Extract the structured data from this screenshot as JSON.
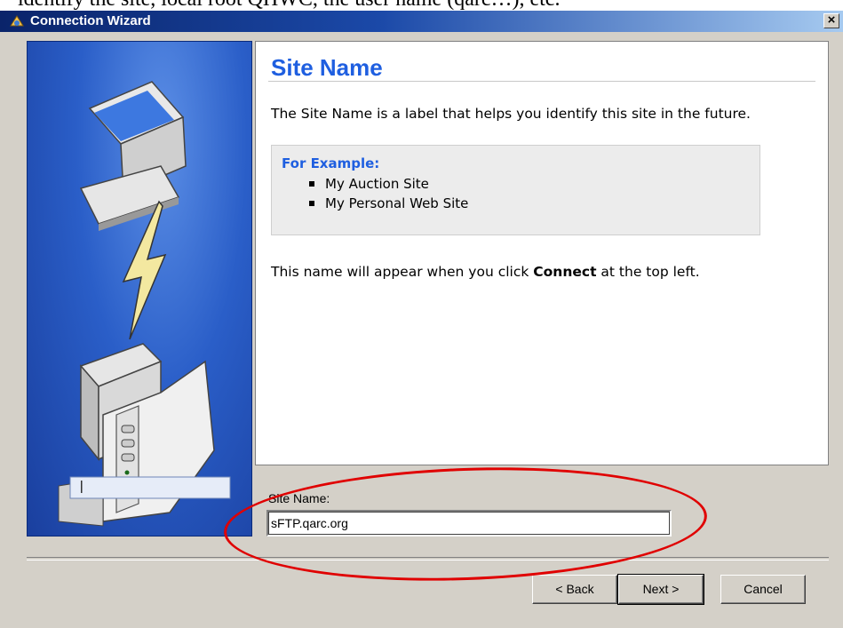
{
  "document": {
    "caption_fragment": "identify the site, local root QHWC, the user name (qarc…), etc."
  },
  "window": {
    "title": "Connection Wizard",
    "close_glyph": "×"
  },
  "content": {
    "heading": "Site Name",
    "intro": "The Site Name is a label that helps you identify this site in the future.",
    "example": {
      "heading": "For Example:",
      "items": [
        "My Auction Site",
        "My Personal Web Site"
      ]
    },
    "note_prefix": "This name will appear when you click ",
    "note_bold": "Connect",
    "note_suffix": " at the top left."
  },
  "form": {
    "label": "Site Name:",
    "value": "sFTP.qarc.org"
  },
  "buttons": {
    "back": "< Back",
    "next": "Next >",
    "cancel": "Cancel"
  },
  "icons": {
    "app": "connection-wizard-icon",
    "close": "close-icon",
    "illustration": "computer-to-server-connection-illustration"
  },
  "colors": {
    "accent": "#1f5fe0",
    "annotation": "#e00000",
    "title_bar": "#0a246a"
  }
}
